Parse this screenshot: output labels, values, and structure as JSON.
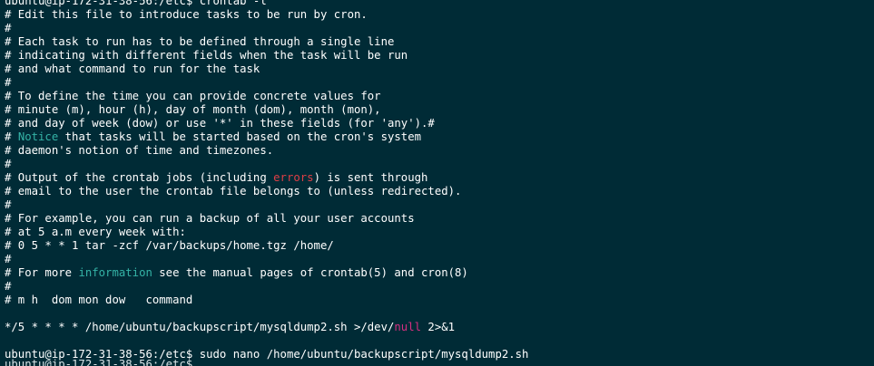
{
  "terminal": {
    "lines": [
      {
        "segments": [
          {
            "text": "ubuntu@ip-172-31-38-56:/etc$ crontab -l",
            "color": "#ffffff"
          }
        ]
      },
      {
        "segments": [
          {
            "text": "# Edit this file to introduce tasks to be run by cron.",
            "color": "#ffffff"
          }
        ]
      },
      {
        "segments": [
          {
            "text": "#",
            "color": "#ffffff"
          }
        ]
      },
      {
        "segments": [
          {
            "text": "# Each task to run has to be defined through a single line",
            "color": "#ffffff"
          }
        ]
      },
      {
        "segments": [
          {
            "text": "# indicating with different fields when the task will be run",
            "color": "#ffffff"
          }
        ]
      },
      {
        "segments": [
          {
            "text": "# and what command to run for the task",
            "color": "#ffffff"
          }
        ]
      },
      {
        "segments": [
          {
            "text": "#",
            "color": "#ffffff"
          }
        ]
      },
      {
        "segments": [
          {
            "text": "# To define the time you can provide concrete values for",
            "color": "#ffffff"
          }
        ]
      },
      {
        "segments": [
          {
            "text": "# minute (m), hour (h), day of month (dom), month (mon),",
            "color": "#ffffff"
          }
        ]
      },
      {
        "segments": [
          {
            "text": "# and day of week (dow) or use '*' in these fields (for 'any').#",
            "color": "#ffffff"
          }
        ]
      },
      {
        "segments": [
          {
            "text": "# ",
            "color": "#ffffff"
          },
          {
            "text": "Notice",
            "color": "#34b3a6"
          },
          {
            "text": " that tasks will be started based on the cron's system",
            "color": "#ffffff"
          }
        ]
      },
      {
        "segments": [
          {
            "text": "# daemon's notion of time and timezones.",
            "color": "#ffffff"
          }
        ]
      },
      {
        "segments": [
          {
            "text": "#",
            "color": "#ffffff"
          }
        ]
      },
      {
        "segments": [
          {
            "text": "# Output of the crontab jobs (including ",
            "color": "#ffffff"
          },
          {
            "text": "errors",
            "color": "#df3f46"
          },
          {
            "text": ") is sent through",
            "color": "#ffffff"
          }
        ]
      },
      {
        "segments": [
          {
            "text": "# email to the user the crontab file belongs to (unless redirected).",
            "color": "#ffffff"
          }
        ]
      },
      {
        "segments": [
          {
            "text": "#",
            "color": "#ffffff"
          }
        ]
      },
      {
        "segments": [
          {
            "text": "# For example, you can run a backup of all your user accounts",
            "color": "#ffffff"
          }
        ]
      },
      {
        "segments": [
          {
            "text": "# at 5 a.m every week with:",
            "color": "#ffffff"
          }
        ]
      },
      {
        "segments": [
          {
            "text": "# 0 5 * * 1 tar -zcf /var/backups/home.tgz /home/",
            "color": "#ffffff"
          }
        ]
      },
      {
        "segments": [
          {
            "text": "#",
            "color": "#ffffff"
          }
        ]
      },
      {
        "segments": [
          {
            "text": "# For more ",
            "color": "#ffffff"
          },
          {
            "text": "information",
            "color": "#34b3a6"
          },
          {
            "text": " see the manual pages of crontab(5) and cron(8)",
            "color": "#ffffff"
          }
        ]
      },
      {
        "segments": [
          {
            "text": "#",
            "color": "#ffffff"
          }
        ]
      },
      {
        "segments": [
          {
            "text": "# m h  dom mon dow   command",
            "color": "#ffffff"
          }
        ]
      },
      {
        "segments": [
          {
            "text": "",
            "color": "#ffffff"
          }
        ]
      },
      {
        "segments": [
          {
            "text": "*/5 * * * * /home/ubuntu/backupscript/mysqldump2.sh >/dev/",
            "color": "#ffffff"
          },
          {
            "text": "null",
            "color": "#d52f81"
          },
          {
            "text": " 2>&1",
            "color": "#ffffff"
          }
        ]
      },
      {
        "segments": [
          {
            "text": "",
            "color": "#ffffff"
          }
        ]
      },
      {
        "segments": [
          {
            "text": "ubuntu@ip-172-31-38-56:/etc$ sudo nano /home/ubuntu/backupscript/mysqldump2.sh",
            "color": "#ffffff"
          }
        ]
      }
    ],
    "partial_bottom_line": "ubuntu@ip-172-31-38-56:/etc$"
  }
}
